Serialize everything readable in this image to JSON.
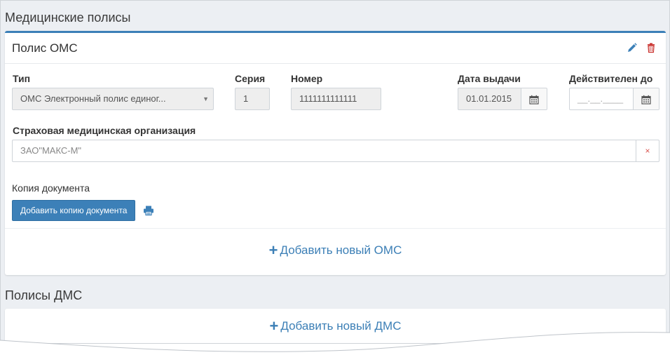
{
  "sections": {
    "oms_title": "Медицинские полисы",
    "dms_title": "Полисы ДМС"
  },
  "oms_card": {
    "title": "Полис ОМС",
    "edit_icon": "pencil-icon",
    "delete_icon": "trash-icon",
    "fields": {
      "type_label": "Тип",
      "type_value": "ОМС Электронный полис единог...",
      "series_label": "Серия",
      "series_value": "1",
      "number_label": "Номер",
      "number_value": "1111111111111",
      "issue_date_label": "Дата выдачи",
      "issue_date_value": "01.01.2015",
      "valid_until_label": "Действителен до",
      "valid_until_placeholder": "__.__.____",
      "insurer_label": "Страховая медицинская организация",
      "insurer_value": "ЗАО\"МАКС-М\"",
      "insurer_clear": "×"
    },
    "copy": {
      "label": "Копия документа",
      "add_button": "Добавить копию документа",
      "print_icon": "printer-icon"
    },
    "add_new": "Добавить новый ОМС"
  },
  "dms_card": {
    "add_new": "Добавить новый ДМС"
  },
  "colors": {
    "accent": "#3c80b8",
    "link": "#3c7fb6",
    "delete": "#c9302c",
    "background": "#eceff3"
  }
}
